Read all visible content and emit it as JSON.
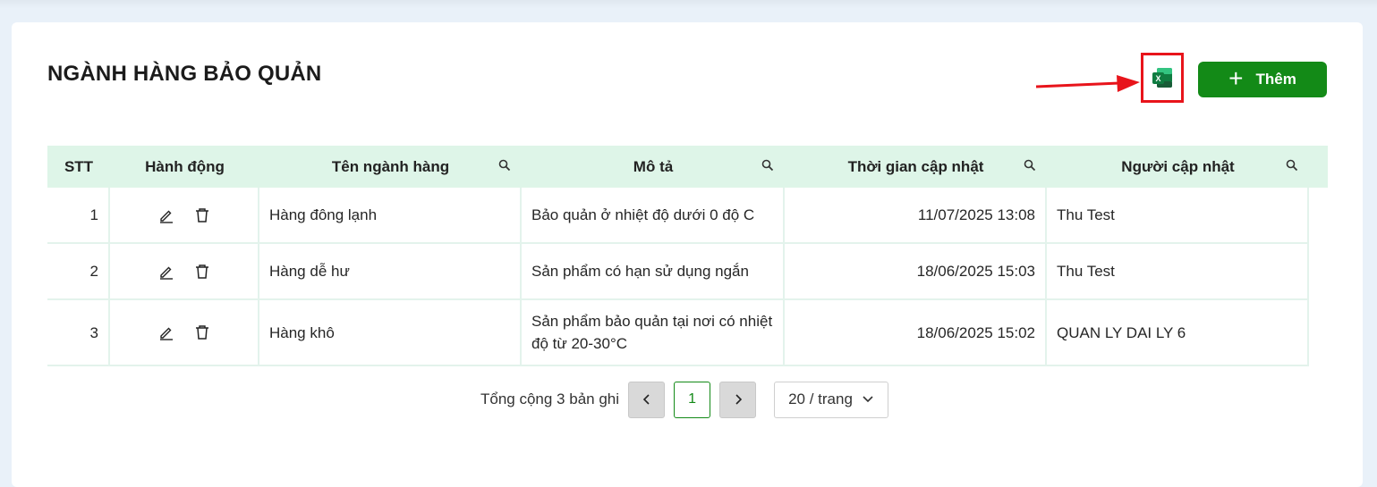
{
  "header": {
    "title": "NGÀNH HÀNG BẢO QUẢN",
    "add_label": "Thêm",
    "export_icon": "excel-icon",
    "accent": "#138a17",
    "highlight": "#e8141b"
  },
  "table": {
    "columns": [
      "STT",
      "Hành động",
      "Tên ngành hàng",
      "Mô tả",
      "Thời gian cập nhật",
      "Người cập nhật"
    ],
    "rows": [
      {
        "stt": "1",
        "name": "Hàng đông lạnh",
        "desc": "Bảo quản ở nhiệt độ dưới 0 độ C",
        "time": "11/07/2025 13:08",
        "user": "Thu Test"
      },
      {
        "stt": "2",
        "name": "Hàng dễ hư",
        "desc": "Sản phẩm có hạn sử dụng ngắn",
        "time": "18/06/2025 15:03",
        "user": "Thu Test"
      },
      {
        "stt": "3",
        "name": "Hàng khô",
        "desc": "Sản phẩm bảo quản tại nơi có nhiệt độ từ 20-30°C",
        "time": "18/06/2025 15:02",
        "user": "QUAN LY DAI LY 6"
      }
    ]
  },
  "pagination": {
    "total": "Tổng cộng 3 bản ghi",
    "current_page": "1",
    "page_size": "20 / trang"
  }
}
